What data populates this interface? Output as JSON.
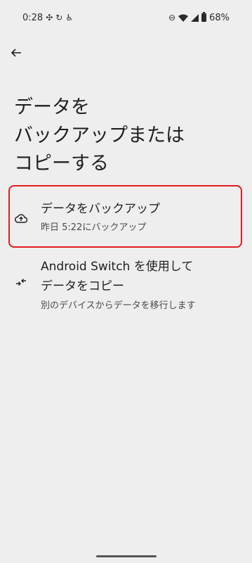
{
  "status_bar": {
    "time": "0:28",
    "battery": "68%"
  },
  "page": {
    "title": "データを\nバックアップまたは\nコピーする"
  },
  "options": {
    "backup": {
      "title": "データをバックアップ",
      "subtitle": "昨日 5:22にバックアップ"
    },
    "switch": {
      "title_line1": "Android Switch を使用して",
      "title_line2": "データをコピー",
      "subtitle": "別のデバイスからデータを移行します"
    }
  },
  "icons": {
    "back": "arrow-back-icon",
    "backup": "cloud-upload-icon",
    "switch": "transfer-arrows-icon"
  },
  "colors": {
    "highlight": "#e31b23",
    "background": "#eeeeee"
  }
}
